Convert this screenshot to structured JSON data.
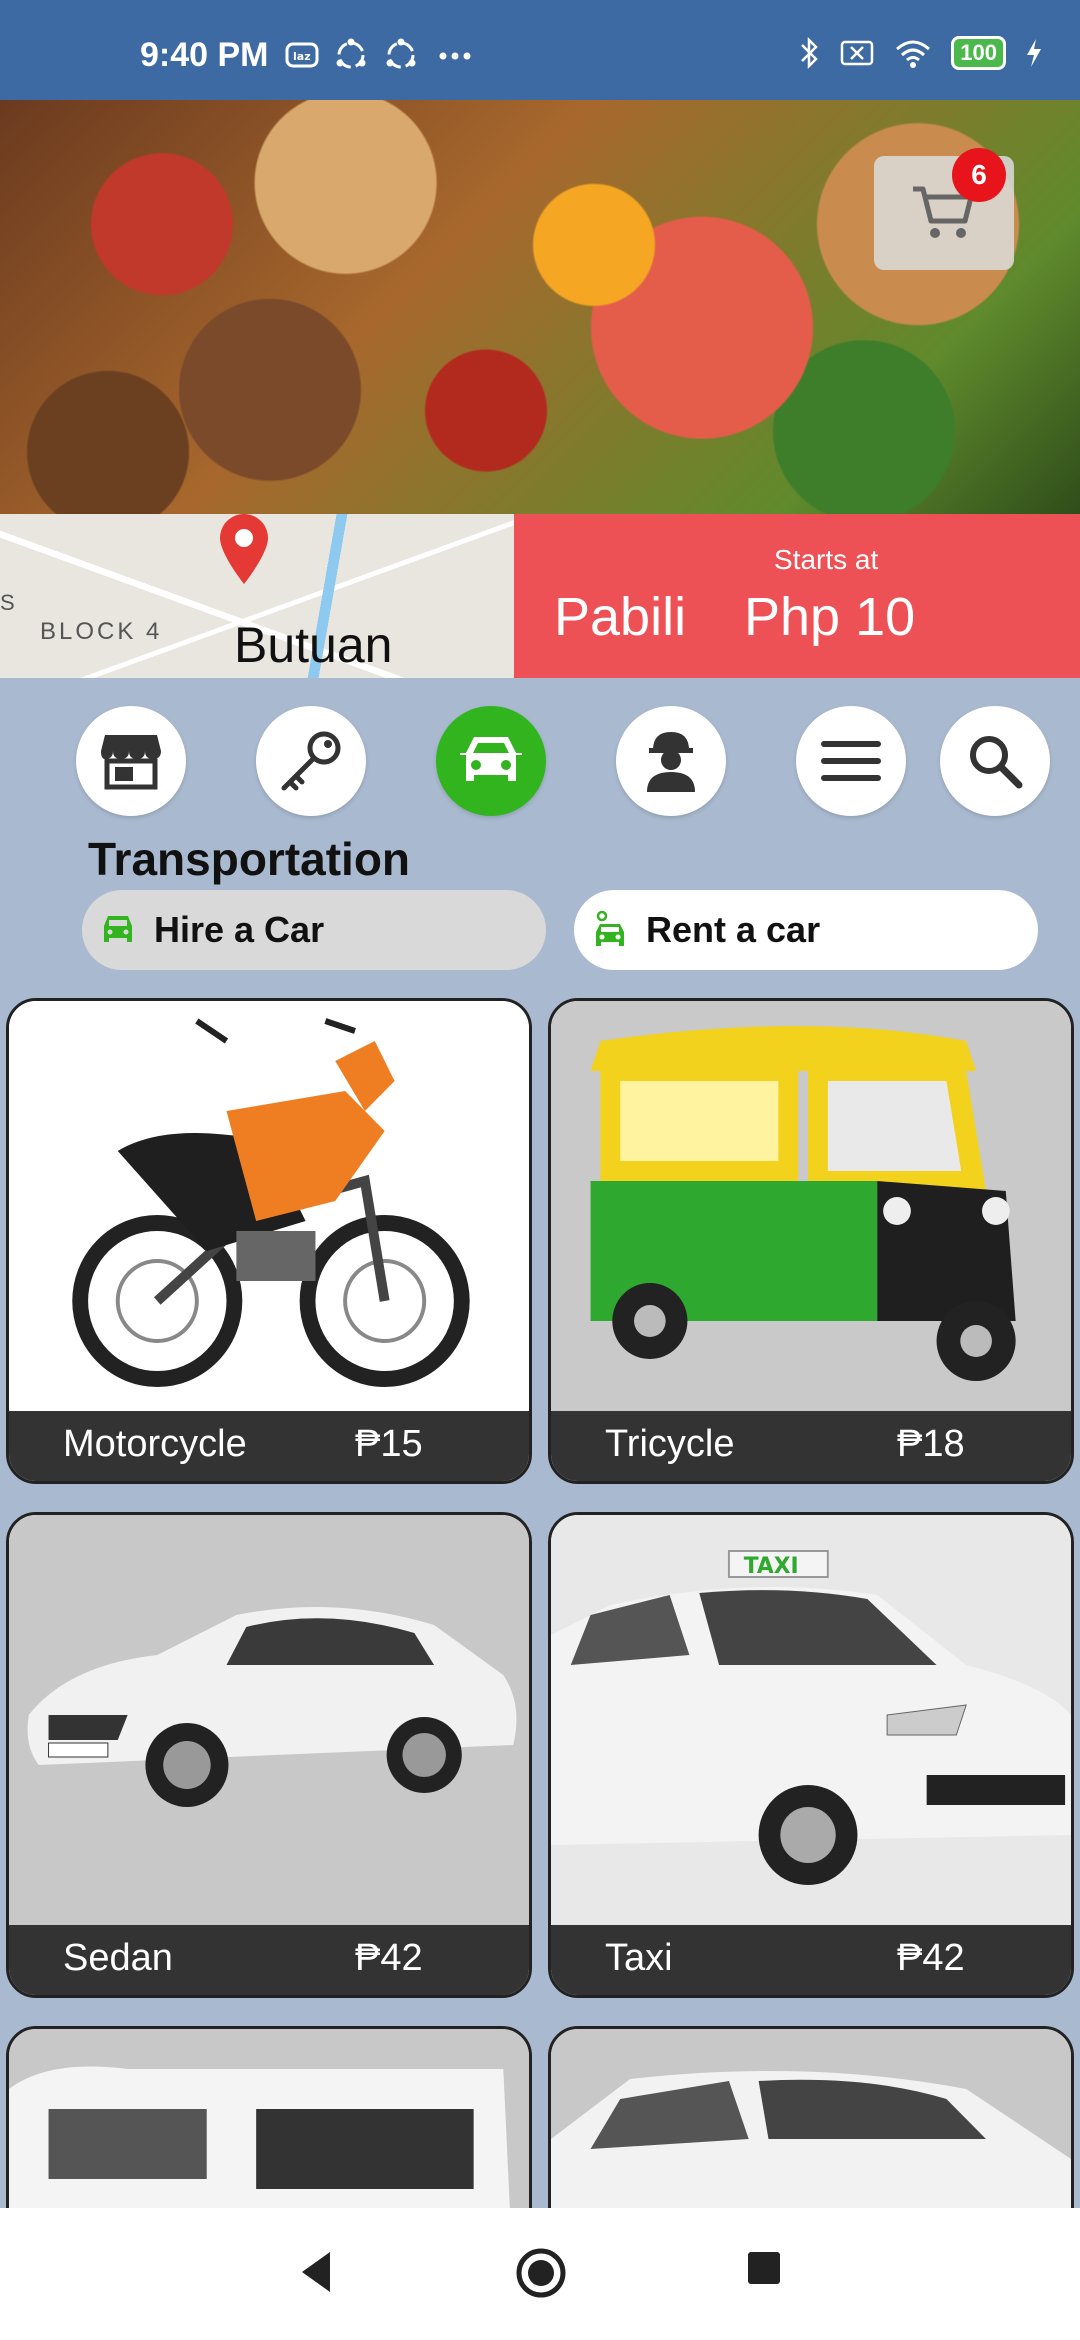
{
  "status_bar": {
    "time": "9:40 PM",
    "battery": "100",
    "left_icons": [
      "lazada-icon",
      "sync-icon",
      "sync-icon",
      "more-dots-icon"
    ],
    "right_icons": [
      "bluetooth-icon",
      "no-sim-icon",
      "wifi-icon",
      "battery-icon",
      "charging-icon"
    ]
  },
  "cart": {
    "badge_count": "6"
  },
  "map": {
    "block_label": "BLOCK 4",
    "edge_letter": "S",
    "city": "Butuan"
  },
  "promo": {
    "subtitle": "Starts at",
    "name": "Pabili",
    "price": "Php 10"
  },
  "categories": [
    {
      "icon": "store-icon",
      "active": false
    },
    {
      "icon": "key-icon",
      "active": false
    },
    {
      "icon": "car-icon",
      "active": true
    },
    {
      "icon": "worker-icon",
      "active": false
    },
    {
      "icon": "menu-icon",
      "active": false
    },
    {
      "icon": "search-icon",
      "active": false
    }
  ],
  "section": {
    "title": "Transportation"
  },
  "pills": {
    "hire_label": "Hire a Car",
    "rent_label": "Rent a car"
  },
  "vehicles": [
    {
      "name": "Motorcycle",
      "price": "₱15"
    },
    {
      "name": "Tricycle",
      "price": "₱18"
    },
    {
      "name": "Sedan",
      "price": "₱42"
    },
    {
      "name": "Taxi",
      "price": "₱42"
    }
  ],
  "taxi_sign": "TAXI",
  "colors": {
    "status_bar": "#3d6aa3",
    "accent_green": "#32b41f",
    "promo_red": "#ed5055",
    "background": "#a9bad0"
  }
}
